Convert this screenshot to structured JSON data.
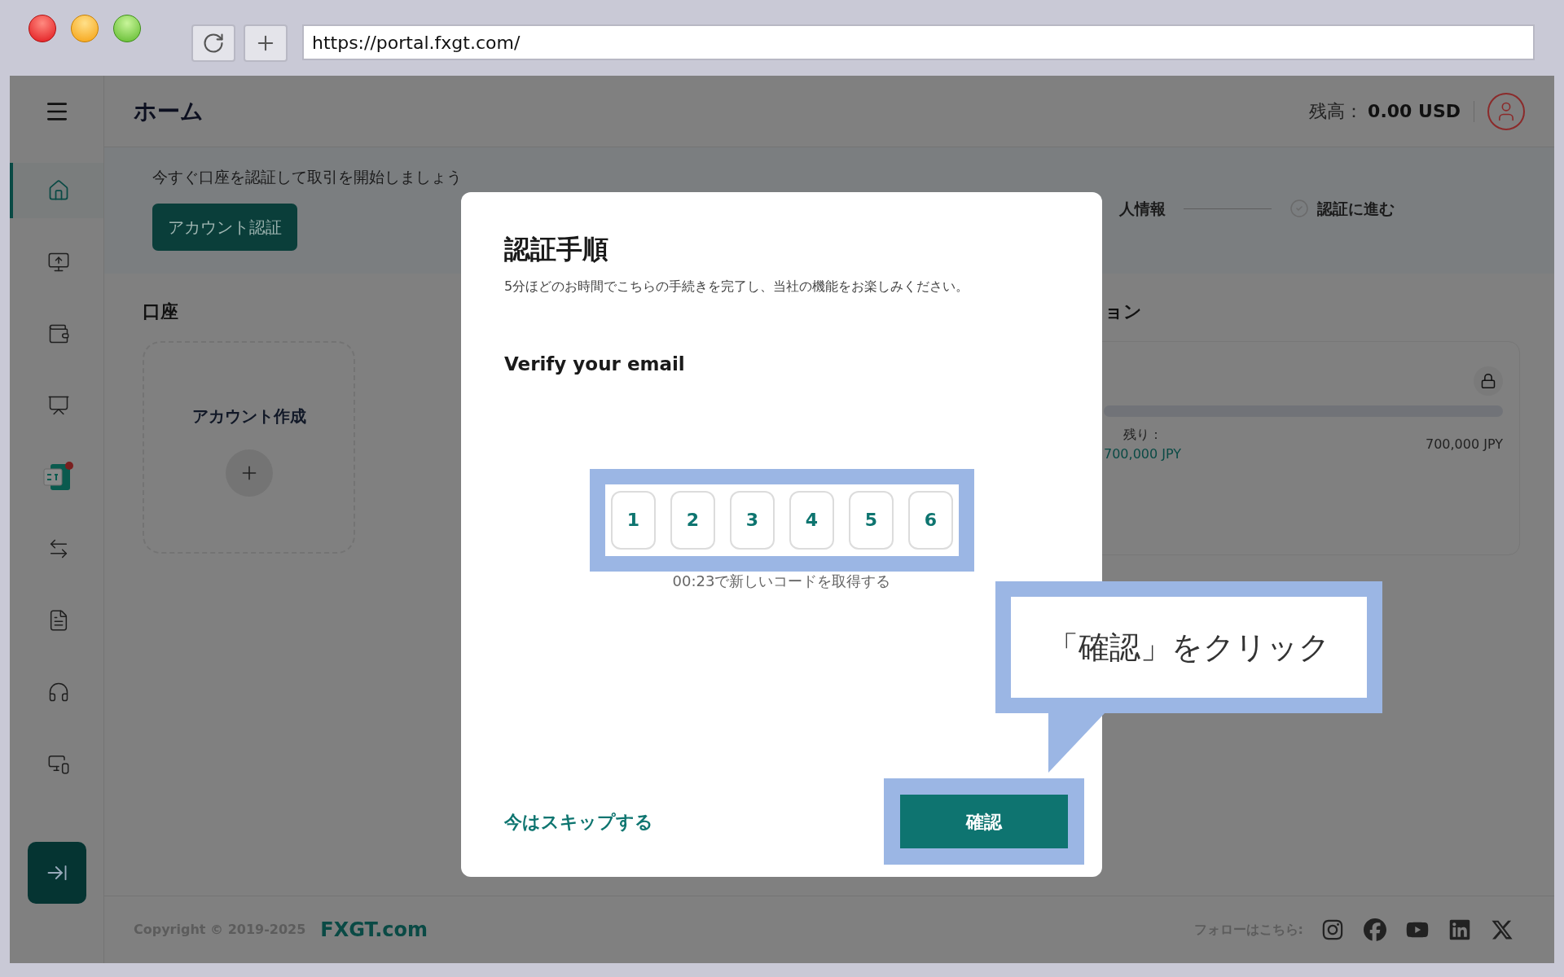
{
  "browser": {
    "url": "https://portal.fxgt.com/"
  },
  "sidebar": {
    "items": [
      {
        "kind": "home",
        "selected": true
      },
      {
        "kind": "transfer-screen",
        "selected": false
      },
      {
        "kind": "wallet",
        "selected": false
      },
      {
        "kind": "chart-dollar",
        "selected": false
      },
      {
        "kind": "ct-app",
        "selected": false
      },
      {
        "kind": "exchange",
        "selected": false
      },
      {
        "kind": "document",
        "selected": false
      },
      {
        "kind": "headset",
        "selected": false
      },
      {
        "kind": "devices",
        "selected": false
      }
    ]
  },
  "header": {
    "title": "ホーム",
    "balance_label": "残高：",
    "balance_value": "0.00 USD"
  },
  "banner": {
    "message": "今すぐ口座を認証して取引を開始しましょう",
    "button": "アカウント認証",
    "steps": [
      {
        "label": "人情報"
      },
      {
        "label": "認証に進む"
      }
    ]
  },
  "accounts": {
    "title": "口座",
    "create_label": "アカウント作成"
  },
  "promotion": {
    "title": "ョン",
    "remaining_label": "残り：",
    "remaining_value": "700,000 JPY",
    "total": "700,000 JPY",
    "level": 0
  },
  "modal": {
    "title": "認証手順",
    "subtitle": "5分ほどのお時間でこちらの手続きを完了し、当社の機能をお楽しみください。",
    "step_title": "Verify your email",
    "code": [
      "1",
      "2",
      "3",
      "4",
      "5",
      "6"
    ],
    "resend": "00:23で新しいコードを取得する",
    "skip": "今はスキップする",
    "confirm": "確認"
  },
  "callout": {
    "text": "「確認」をクリック"
  },
  "footer": {
    "copyright": "Copyright © 2019-2025",
    "brand": "FXGT.com",
    "follow": "フォローはこちら:",
    "social": [
      {
        "kind": "instagram"
      },
      {
        "kind": "facebook"
      },
      {
        "kind": "youtube"
      },
      {
        "kind": "linkedin"
      },
      {
        "kind": "x"
      }
    ]
  }
}
